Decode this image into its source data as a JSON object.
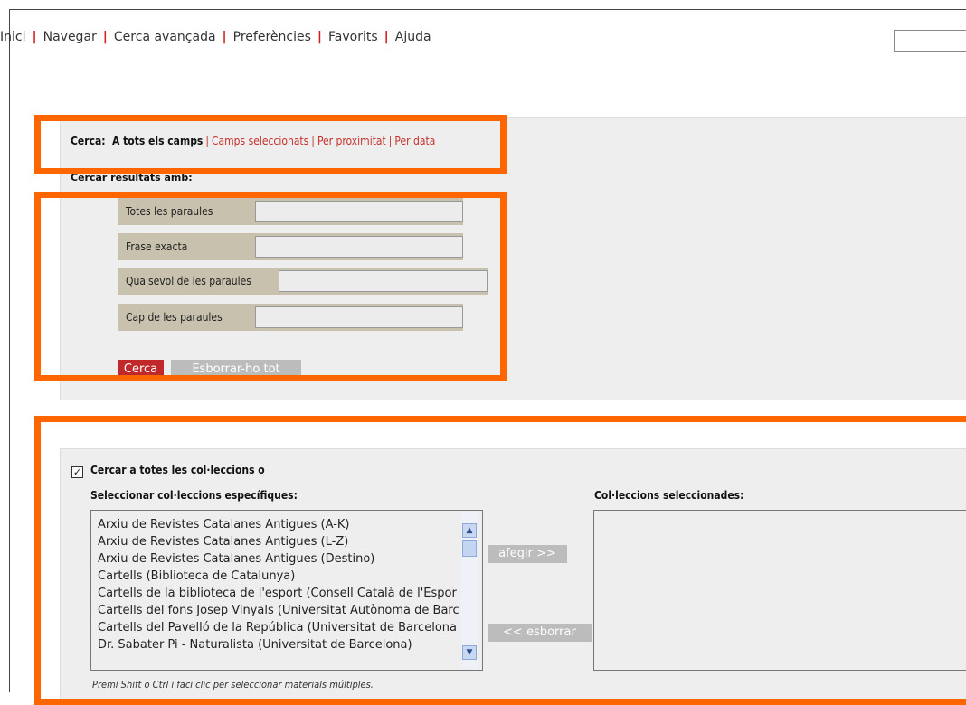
{
  "top_nav": {
    "items": [
      "Inici",
      "Navegar",
      "Cerca avançada",
      "Preferències",
      "Favorits",
      "Ajuda"
    ],
    "separator": "|"
  },
  "search_tabs": {
    "label": "Cerca:",
    "active": "A tots els camps",
    "others": [
      "Camps seleccionats",
      "Per proximitat",
      "Per data"
    ],
    "separator": "|"
  },
  "results_label": "Cercar resultats amb:",
  "fields": [
    {
      "label": "Totes les paraules",
      "value": ""
    },
    {
      "label": "Frase exacta",
      "value": ""
    },
    {
      "label": "Qualsevol de les paraules",
      "value": ""
    },
    {
      "label": "Cap de les paraules",
      "value": ""
    }
  ],
  "buttons": {
    "search": "Cerca",
    "clear_all": "Esborrar-ho tot",
    "add": "afegir >>",
    "remove": "<< esborrar"
  },
  "collections": {
    "all_checkbox_label": "Cercar a totes les col·leccions o",
    "all_checked": true,
    "select_label": "Seleccionar col·leccions específiques:",
    "selected_label": "Col·leccions seleccionades:",
    "items": [
      "Arxiu de Revistes Catalanes Antigues (A-K)",
      "Arxiu de Revistes Catalanes Antigues (L-Z)",
      "Arxiu de Revistes Catalanes Antigues (Destino)",
      "Cartells (Biblioteca de Catalunya)",
      "Cartells de la biblioteca de l'esport (Consell Català de l'Espor",
      "Cartells del fons Josep Vinyals (Universitat Autònoma de Barc",
      "Cartells del Pavelló de la República (Universitat de Barcelona",
      "Dr. Sabater Pi - Naturalista (Universitat de Barcelona)"
    ],
    "hint": "Premi Shift o Ctrl i faci clic per seleccionar materials múltiples."
  },
  "colors": {
    "highlight": "#ff6600",
    "accent_red": "#c0282a",
    "panel": "#eeeeee",
    "label_bg": "#c8c1ad"
  }
}
